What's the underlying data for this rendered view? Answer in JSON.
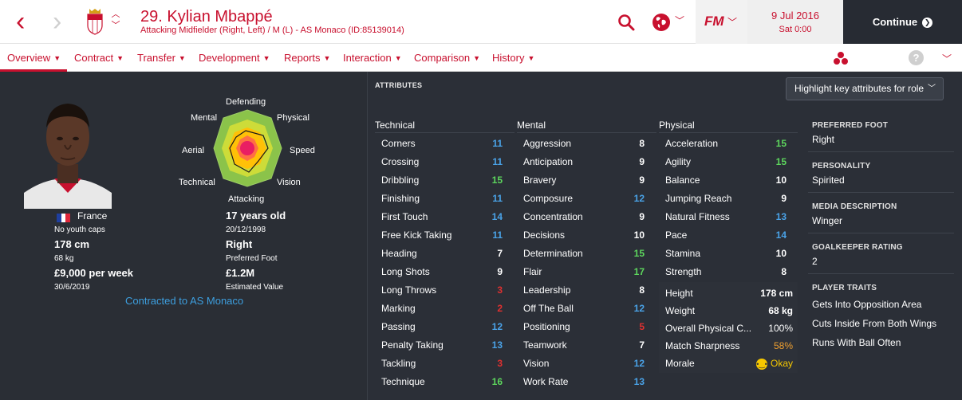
{
  "header": {
    "player_title": "29. Kylian Mbappé",
    "player_subtitle": "Attacking Midfielder (Right, Left) / M (L) - AS Monaco (ID:85139014)",
    "fm_logo": "FM",
    "date": "9 Jul 2016",
    "time": "Sat 0:00",
    "continue_label": "Continue"
  },
  "tabs": [
    {
      "label": "Overview"
    },
    {
      "label": "Contract"
    },
    {
      "label": "Transfer"
    },
    {
      "label": "Development"
    },
    {
      "label": "Reports"
    },
    {
      "label": "Interaction"
    },
    {
      "label": "Comparison"
    },
    {
      "label": "History"
    }
  ],
  "profile": {
    "nationality": "France",
    "youth_caps": "No youth caps",
    "height": "178 cm",
    "weight": "68 kg",
    "wage": "£9,000 per week",
    "contract_end": "30/6/2019",
    "age": "17 years old",
    "dob": "20/12/1998",
    "foot": "Right",
    "foot_label": "Preferred Foot",
    "value": "£1.2M",
    "value_label": "Estimated Value",
    "contract_link": "Contracted to AS Monaco"
  },
  "radar_labels": {
    "defending": "Defending",
    "physical": "Physical",
    "speed": "Speed",
    "vision": "Vision",
    "attacking": "Attacking",
    "technical": "Technical",
    "aerial": "Aerial",
    "mental": "Mental"
  },
  "attributes": {
    "heading": "ATTRIBUTES",
    "highlight_label": "Highlight key attributes for role",
    "technical_title": "Technical",
    "mental_title": "Mental",
    "physical_title": "Physical",
    "technical": [
      {
        "name": "Corners",
        "value": "11"
      },
      {
        "name": "Crossing",
        "value": "11"
      },
      {
        "name": "Dribbling",
        "value": "15"
      },
      {
        "name": "Finishing",
        "value": "11"
      },
      {
        "name": "First Touch",
        "value": "14"
      },
      {
        "name": "Free Kick Taking",
        "value": "11"
      },
      {
        "name": "Heading",
        "value": "7"
      },
      {
        "name": "Long Shots",
        "value": "9"
      },
      {
        "name": "Long Throws",
        "value": "3"
      },
      {
        "name": "Marking",
        "value": "2"
      },
      {
        "name": "Passing",
        "value": "12"
      },
      {
        "name": "Penalty Taking",
        "value": "13"
      },
      {
        "name": "Tackling",
        "value": "3"
      },
      {
        "name": "Technique",
        "value": "16"
      }
    ],
    "mental": [
      {
        "name": "Aggression",
        "value": "8"
      },
      {
        "name": "Anticipation",
        "value": "9"
      },
      {
        "name": "Bravery",
        "value": "9"
      },
      {
        "name": "Composure",
        "value": "12"
      },
      {
        "name": "Concentration",
        "value": "9"
      },
      {
        "name": "Decisions",
        "value": "10"
      },
      {
        "name": "Determination",
        "value": "15"
      },
      {
        "name": "Flair",
        "value": "17"
      },
      {
        "name": "Leadership",
        "value": "8"
      },
      {
        "name": "Off The Ball",
        "value": "12"
      },
      {
        "name": "Positioning",
        "value": "5"
      },
      {
        "name": "Teamwork",
        "value": "7"
      },
      {
        "name": "Vision",
        "value": "12"
      },
      {
        "name": "Work Rate",
        "value": "13"
      }
    ],
    "physical": [
      {
        "name": "Acceleration",
        "value": "15"
      },
      {
        "name": "Agility",
        "value": "15"
      },
      {
        "name": "Balance",
        "value": "10"
      },
      {
        "name": "Jumping Reach",
        "value": "9"
      },
      {
        "name": "Natural Fitness",
        "value": "13"
      },
      {
        "name": "Pace",
        "value": "14"
      },
      {
        "name": "Stamina",
        "value": "10"
      },
      {
        "name": "Strength",
        "value": "8"
      }
    ],
    "stats": [
      {
        "name": "Height",
        "value": "178 cm"
      },
      {
        "name": "Weight",
        "value": "68 kg"
      },
      {
        "name": "Overall Physical C...",
        "value": "100%"
      },
      {
        "name": "Match Sharpness",
        "value": "58%"
      },
      {
        "name": "Morale",
        "value": "Okay"
      }
    ]
  },
  "side": {
    "preferred_foot_label": "PREFERRED FOOT",
    "preferred_foot": "Right",
    "personality_label": "PERSONALITY",
    "personality": "Spirited",
    "media_label": "MEDIA DESCRIPTION",
    "media": "Winger",
    "gk_label": "GOALKEEPER RATING",
    "gk": "2",
    "traits_label": "PLAYER TRAITS",
    "traits": [
      "Gets Into Opposition Area",
      "Cuts Inside From Both Wings",
      "Runs With Ball Often"
    ]
  },
  "colors": {
    "brand": "#c8102e",
    "good": "#5dd65d",
    "mid": "#4aa3e8",
    "low": "#e03030",
    "neutral": "#ffffff",
    "warn": "#f0a030"
  }
}
